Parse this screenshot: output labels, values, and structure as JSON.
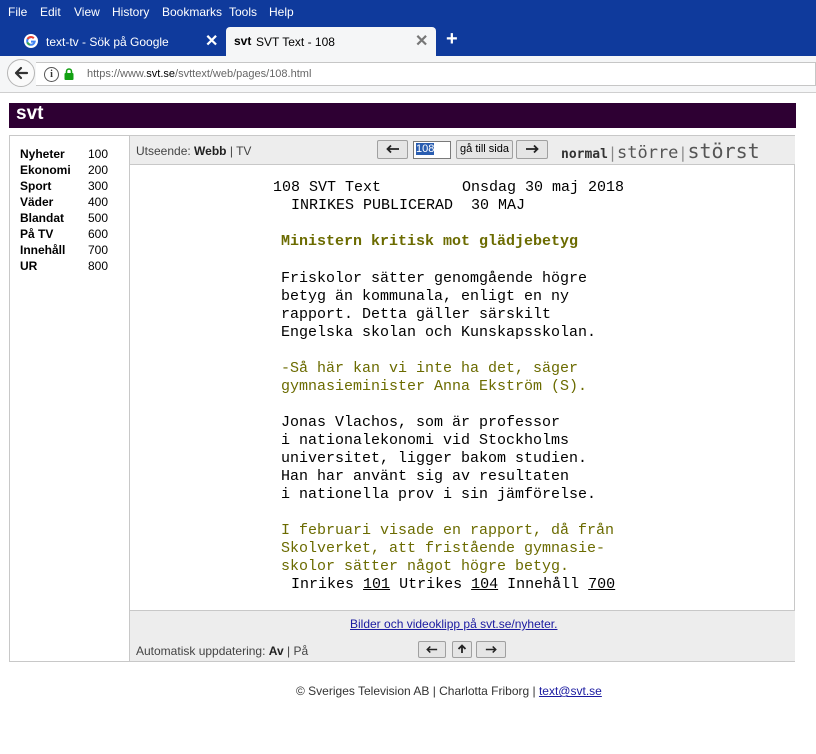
{
  "browser": {
    "menu": [
      "File",
      "Edit",
      "View",
      "History",
      "Bookmarks",
      "Tools",
      "Help"
    ],
    "tabs": [
      {
        "title": "text-tv - Sök på Google",
        "icon": "google-icon",
        "active": false
      },
      {
        "title": "SVT Text - 108",
        "icon": "svt-icon",
        "favicon_text": "svt",
        "active": true
      }
    ],
    "new_tab": "+",
    "url_prefix": "https://www.",
    "url_domain": "svt.se",
    "url_path": "/svttext/web/pages/108.html"
  },
  "site": {
    "logo": "svt",
    "logo_bg": "#2e0033"
  },
  "sidebar": {
    "items": [
      {
        "label": "Nyheter",
        "page": "100"
      },
      {
        "label": "Ekonomi",
        "page": "200"
      },
      {
        "label": "Sport",
        "page": "300"
      },
      {
        "label": "Väder",
        "page": "400"
      },
      {
        "label": "Blandat",
        "page": "500"
      },
      {
        "label": "På TV",
        "page": "600"
      },
      {
        "label": "Innehåll",
        "page": "700"
      },
      {
        "label": "UR",
        "page": "800"
      }
    ]
  },
  "controls": {
    "utseende_label": "Utseende:",
    "webb": "Webb",
    "sep": "|",
    "tv": "TV",
    "page_value": "108",
    "goto_label": "gå till sida",
    "size_normal": "normal",
    "size_larger": "större",
    "size_largest": "störst"
  },
  "teletext": {
    "header1": "108 SVT Text         Onsdag 30 maj 2018",
    "header2": "INRIKES PUBLICERAD  30 MAJ",
    "headline": "Ministern kritisk mot glädjebetyg",
    "p1": [
      "Friskolor sätter genomgående högre",
      "betyg än kommunala, enligt en ny",
      "rapport. Detta gäller särskilt",
      "Engelska skolan och Kunskapsskolan."
    ],
    "p2": [
      "-Så här kan vi inte ha det, säger",
      "gymnasieminister Anna Ekström (S)."
    ],
    "p3": [
      "Jonas Vlachos, som är professor",
      "i nationalekonomi vid Stockholms",
      "universitet, ligger bakom studien.",
      "Han har använt sig av resultaten",
      "i nationella prov i sin jämförelse."
    ],
    "p4": [
      "I februari visade en rapport, då från",
      "Skolverket, att fristående gymnasie-",
      "skolor sätter något högre betyg."
    ],
    "nav": {
      "inrikes": "Inrikes",
      "inrikes_page": "101",
      "utrikes": "Utrikes",
      "utrikes_page": "104",
      "innehall": "Innehåll",
      "innehall_page": "700"
    }
  },
  "bild_link": "Bilder och videoklipp på svt.se/nyheter.",
  "auto_update": {
    "label": "Automatisk uppdatering:",
    "off": "Av",
    "sep": "|",
    "on": "På"
  },
  "footer": {
    "text": "© Sveriges Television AB | Charlotta Friborg | ",
    "email": "text@svt.se"
  }
}
